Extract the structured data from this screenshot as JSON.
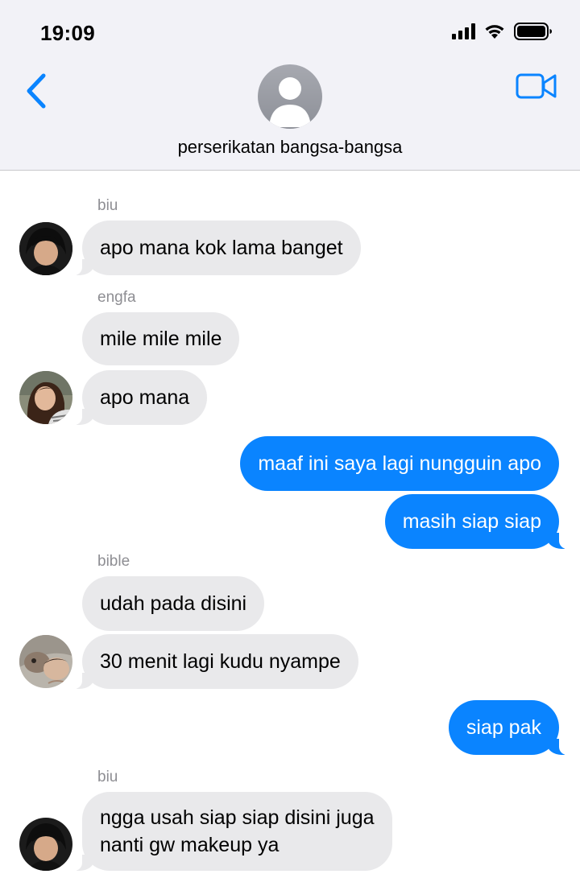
{
  "status_bar": {
    "time": "19:09"
  },
  "header": {
    "group_name": "perserikatan bangsa-bangsa"
  },
  "messages": [
    {
      "sender": "biu",
      "text": "apo mana kok lama banget"
    },
    {
      "sender": "engfa",
      "text": "mile mile mile"
    },
    {
      "text": "apo mana"
    },
    {
      "text": "maaf ini saya lagi nungguin apo"
    },
    {
      "text": "masih siap siap"
    },
    {
      "sender": "bible",
      "text": "udah pada disini"
    },
    {
      "text": "30 menit lagi kudu nyampe"
    },
    {
      "text": "siap pak"
    },
    {
      "sender": "biu",
      "line1": "ngga usah siap siap disini juga",
      "line2": "nanti gw makeup ya"
    }
  ],
  "colors": {
    "sent_bubble": "#0a84ff",
    "received_bubble": "#e9e9eb",
    "accent": "#0a84ff",
    "header_bg": "#f2f2f7"
  },
  "icons": [
    "chevron-left-icon",
    "video-camera-icon",
    "signal-icon",
    "wifi-icon",
    "battery-icon",
    "person-icon"
  ]
}
